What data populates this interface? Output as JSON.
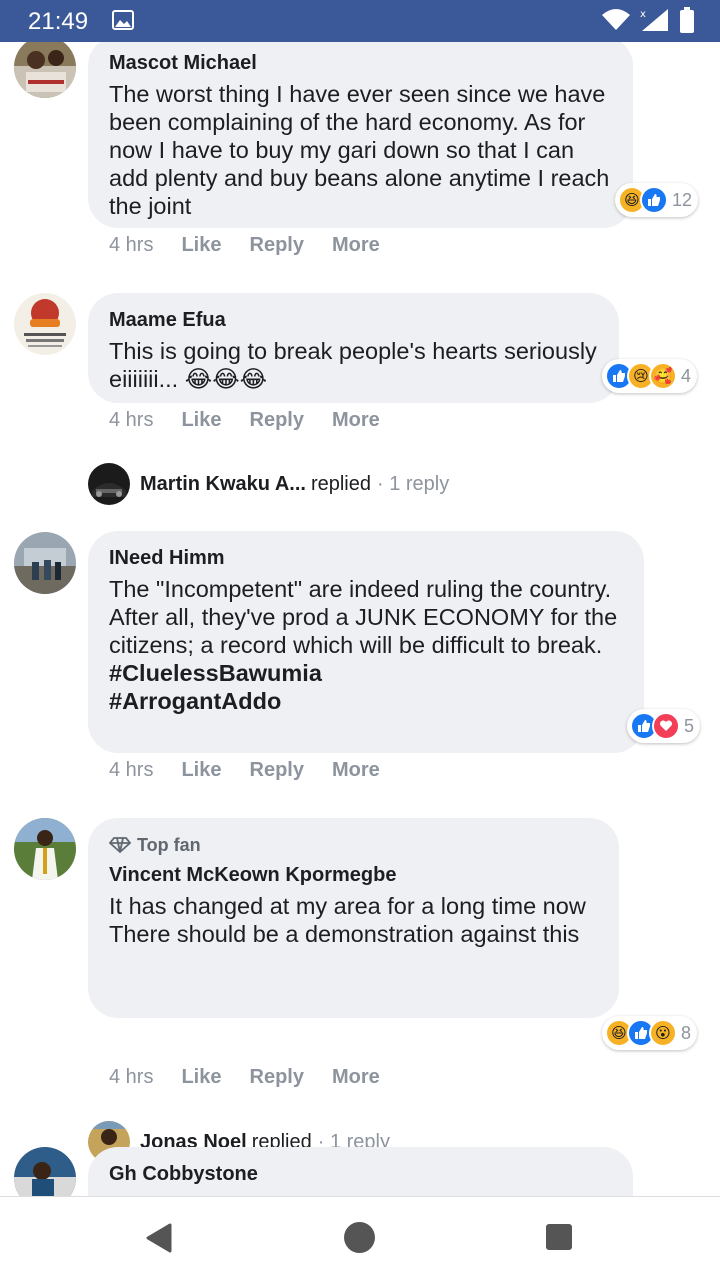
{
  "status_bar": {
    "time": "21:49",
    "icons": [
      "image-icon",
      "wifi-icon",
      "signal-icon",
      "battery-icon"
    ]
  },
  "comments": [
    {
      "author": "Mascot Michael",
      "text": "The worst thing I have ever seen since we have been complaining of the hard economy. As for now I have to buy my gari down so that I can add plenty and buy beans alone anytime I reach the joint",
      "reactions": {
        "icons": [
          "haha",
          "like"
        ],
        "count": "12"
      },
      "time": "4 hrs",
      "like": "Like",
      "reply": "Reply",
      "more": "More"
    },
    {
      "author": "Maame Efua",
      "text": "This is going to break people's hearts seriously eiiiiiii... 😂😂😂",
      "reactions": {
        "icons": [
          "like",
          "sad",
          "care"
        ],
        "count": "4"
      },
      "time": "4 hrs",
      "like": "Like",
      "reply": "Reply",
      "more": "More",
      "replies": {
        "name": "Martin Kwaku A...",
        "verb": "replied",
        "count": "· 1 reply"
      }
    },
    {
      "author": "INeed Himm",
      "text": "The \"Incompetent\" are indeed ruling the country. After all, they've prod a JUNK ECONOMY for the citizens; a record which will be difficult to break.",
      "hashtags": [
        "#CluelessBawumia",
        "#ArrogantAddo"
      ],
      "reactions": {
        "icons": [
          "like",
          "love"
        ],
        "count": "5"
      },
      "time": "4 hrs",
      "like": "Like",
      "reply": "Reply",
      "more": "More"
    },
    {
      "badge": "Top fan",
      "author": "Vincent McKeown Kpormegbe",
      "text": "It has changed at my area for a long time now\nThere should be a demonstration against this",
      "reactions": {
        "icons": [
          "haha",
          "like",
          "wow"
        ],
        "count": "8"
      },
      "time": "4 hrs",
      "like": "Like",
      "reply": "Reply",
      "more": "More",
      "replies": {
        "name": "Jonas Noel",
        "verb": "replied",
        "count": "· 1 reply"
      }
    },
    {
      "author": "Gh Cobbystone"
    }
  ],
  "colors": {
    "status_bar": "#3b5998",
    "bubble": "#eff0f3",
    "meta": "#8d949e",
    "like": "#1877f2",
    "love": "#f33e58",
    "emoji": "#f7b125"
  },
  "nav_bar": {
    "icons": [
      "back-icon",
      "home-icon",
      "recents-icon"
    ]
  }
}
